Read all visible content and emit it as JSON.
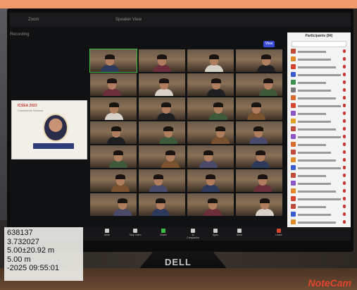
{
  "zoom": {
    "window_title": "Zoom",
    "meeting_title": "Speaker View",
    "sub_title": "Recording",
    "view_button": "View"
  },
  "slide": {
    "title": "ICSEA 2023",
    "subtitle": "Conference Session"
  },
  "gallery": {
    "rows": 7,
    "cols": 4
  },
  "participants": {
    "title": "Participants (84)",
    "rows": [
      {
        "color": "#c14b3a"
      },
      {
        "color": "#e08a2c"
      },
      {
        "color": "#d6452f"
      },
      {
        "color": "#3a5bd0"
      },
      {
        "color": "#3b8f4a"
      },
      {
        "color": "#7a7a7a"
      },
      {
        "color": "#d9692c"
      },
      {
        "color": "#d6452f"
      },
      {
        "color": "#8c55c7"
      },
      {
        "color": "#e0a42c"
      },
      {
        "color": "#c14b3a"
      },
      {
        "color": "#8c55c7"
      },
      {
        "color": "#d9692c"
      },
      {
        "color": "#c14b3a"
      },
      {
        "color": "#e08a2c"
      },
      {
        "color": "#3a5bd0"
      },
      {
        "color": "#c14b3a"
      },
      {
        "color": "#8c55c7"
      },
      {
        "color": "#e08a2c"
      },
      {
        "color": "#d6452f"
      },
      {
        "color": "#c14b3a"
      },
      {
        "color": "#3a5bd0"
      },
      {
        "color": "#e08a2c"
      }
    ]
  },
  "controls": [
    {
      "label": "Mute",
      "icon": "mic-icon"
    },
    {
      "label": "Stop Video",
      "icon": "camera-icon"
    },
    {
      "label": "Share",
      "icon": "share-icon"
    },
    {
      "label": "AI Companion",
      "icon": "sparkle-icon"
    },
    {
      "label": "Apps",
      "icon": "apps-icon"
    },
    {
      "label": "More",
      "icon": "more-icon"
    },
    {
      "label": "Leave",
      "icon": "leave-icon"
    }
  ],
  "gps": {
    "line1": "638137",
    "line2": "3.732027",
    "line3": "5.00±20.92 m",
    "line4": "5.00 m",
    "line5": "-2025 09:55:01"
  },
  "brand": "DELL",
  "watermark": "NoteCam",
  "colors": {
    "top_band": "#ee9a6a",
    "zoom_blue": "#3a4bd8",
    "speaker_outline": "#3fbf3f"
  }
}
